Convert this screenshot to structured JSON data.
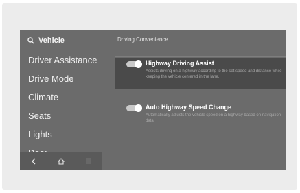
{
  "sidebar": {
    "search_label": "Vehicle",
    "items": [
      {
        "label": "Driver Assistance"
      },
      {
        "label": "Drive Mode"
      },
      {
        "label": "Climate"
      },
      {
        "label": "Seats"
      },
      {
        "label": "Lights"
      },
      {
        "label": "Door"
      }
    ],
    "bottom_icons": [
      "back-icon",
      "home-icon",
      "menu-icon"
    ]
  },
  "main": {
    "section_title": "Driving Convenience",
    "settings": [
      {
        "title": "Highway Driving Assist",
        "description": "Assists driving on a highway according to the set speed and distance while keeping the vehicle centered in the lane.",
        "enabled": true
      },
      {
        "title": "Auto Highway Speed Change",
        "description": "Automatically adjusts the vehicle speed on a highway based on navigation data.",
        "enabled": true
      }
    ]
  }
}
